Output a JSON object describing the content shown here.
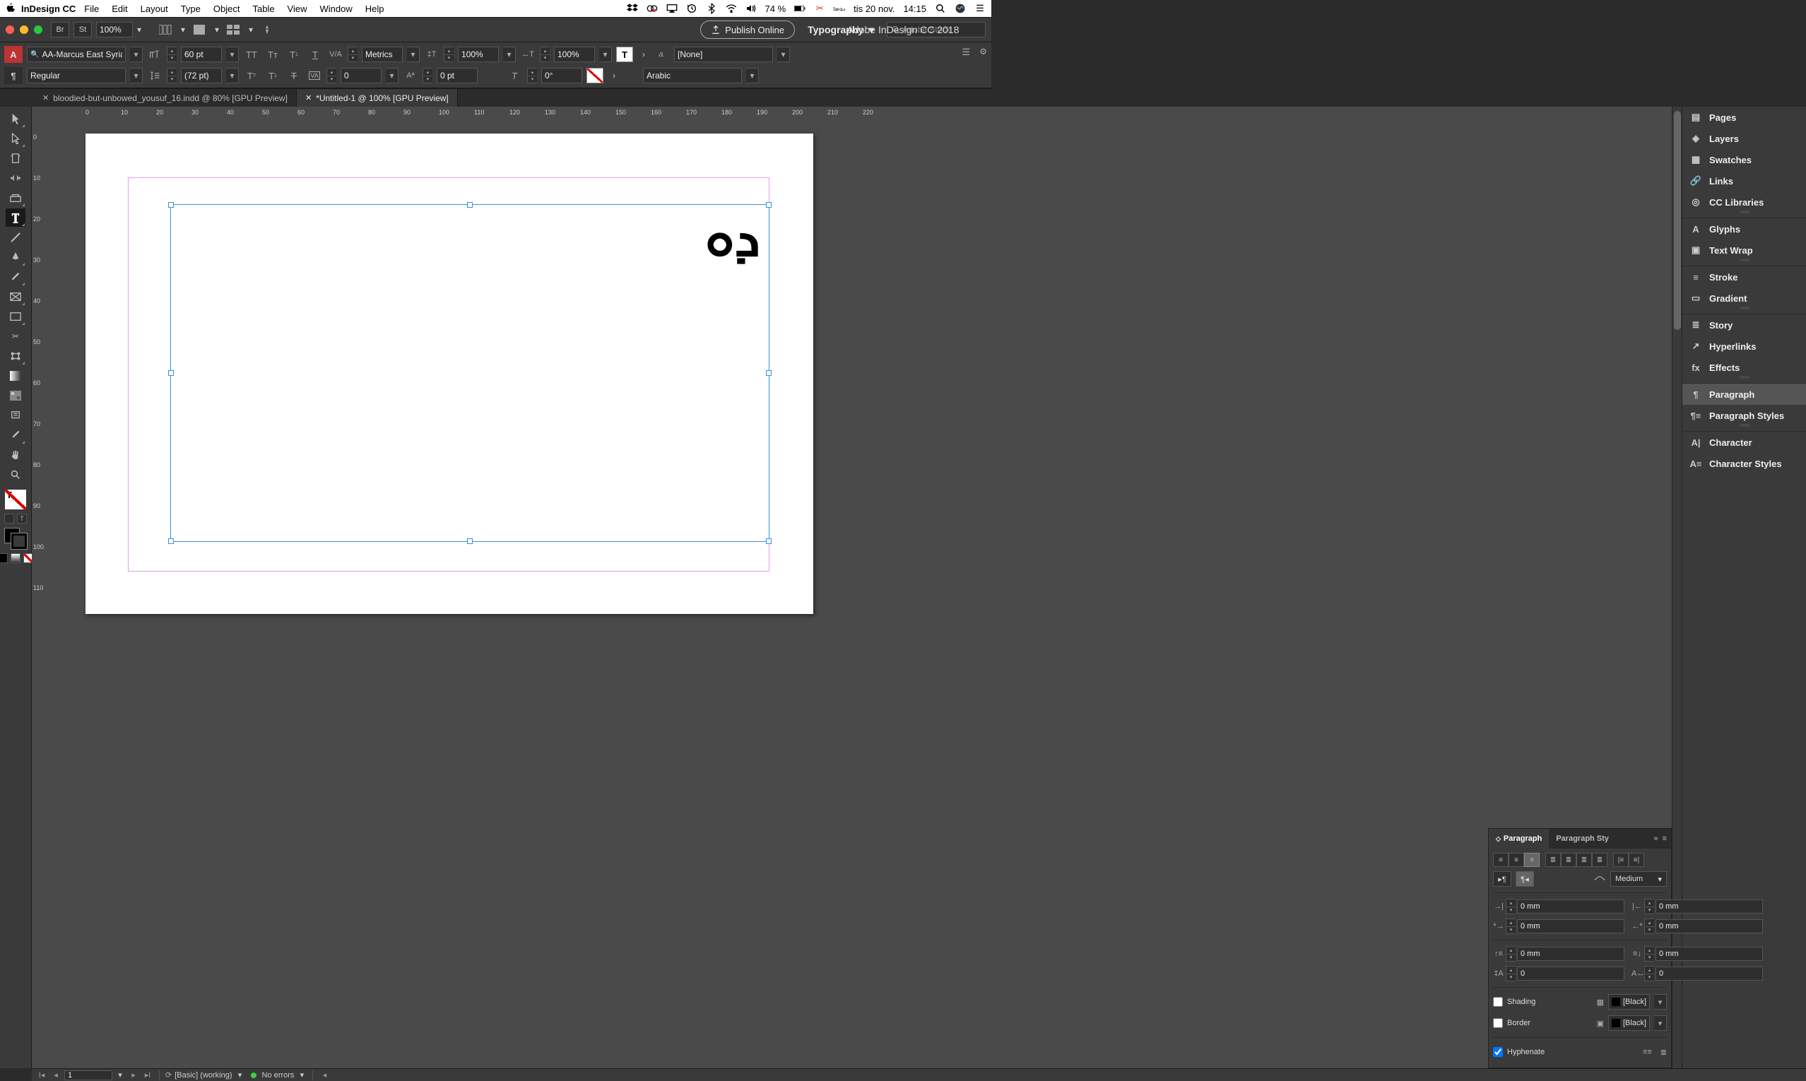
{
  "menubar": {
    "app": "InDesign CC",
    "items": [
      "File",
      "Edit",
      "Layout",
      "Type",
      "Object",
      "Table",
      "View",
      "Window",
      "Help"
    ],
    "battery": "74 %",
    "date": "tis 20 nov.",
    "time": "14:15"
  },
  "appbar": {
    "zoom": "100%",
    "title": "Adobe InDesign CC 2018",
    "publish": "Publish Online",
    "workspace": "Typography",
    "search_placeholder": "Adobe Stock"
  },
  "control": {
    "font": "AA-Marcus East Syria",
    "style": "Regular",
    "size": "60 pt",
    "leading": "(72 pt)",
    "kerning": "Metrics",
    "tracking": "0",
    "vscale": "100%",
    "hscale": "100%",
    "baseline": "0 pt",
    "skew": "0°",
    "charstyle": "[None]",
    "language": "Arabic",
    "a_label": "a."
  },
  "tabs": [
    {
      "label": "bloodied-but-unbowed_yousuf_16.indd @ 80% [GPU Preview]",
      "active": false
    },
    {
      "label": "*Untitled-1 @ 100% [GPU Preview]",
      "active": true
    }
  ],
  "ruler": {
    "h": [
      "0",
      "10",
      "20",
      "30",
      "40",
      "50",
      "60",
      "70",
      "80",
      "90",
      "100",
      "110",
      "120",
      "130",
      "140",
      "150",
      "160",
      "170",
      "180",
      "190",
      "200",
      "210",
      "220"
    ],
    "v": [
      "0",
      "10",
      "20",
      "30",
      "40",
      "50",
      "60",
      "70",
      "80",
      "90",
      "100",
      "110"
    ]
  },
  "document": {
    "glyph": "ܕܘ"
  },
  "right_panels": {
    "groups": [
      [
        "Pages",
        "Layers",
        "Swatches",
        "Links",
        "CC Libraries"
      ],
      [
        "Glyphs",
        "Text Wrap"
      ],
      [
        "Stroke",
        "Gradient"
      ],
      [
        "Story",
        "Hyperlinks",
        "Effects"
      ],
      [
        "Paragraph",
        "Paragraph Styles"
      ],
      [
        "Character",
        "Character Styles"
      ]
    ],
    "active": "Paragraph"
  },
  "paragraph_panel": {
    "tab1": "Paragraph",
    "tab2": "Paragraph Sty",
    "kashida": "Medium",
    "left_indent": "0 mm",
    "right_indent": "0 mm",
    "first_indent": "0 mm",
    "last_indent": "0 mm",
    "space_before": "0 mm",
    "space_after": "0 mm",
    "drop_lines": "0",
    "drop_chars": "0",
    "shading_label": "Shading",
    "shading_color": "[Black]",
    "border_label": "Border",
    "border_color": "[Black]",
    "hyphenate": "Hyphenate"
  },
  "status": {
    "page": "1",
    "preflight": "[Basic] (working)",
    "errors": "No errors"
  }
}
